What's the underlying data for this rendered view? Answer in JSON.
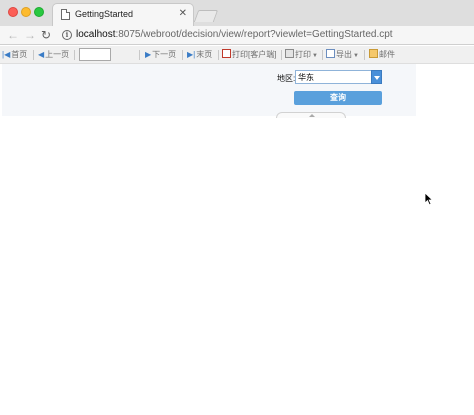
{
  "browser": {
    "tab": {
      "title": "GettingStarted",
      "close_icon": "close-icon",
      "doc_icon": "document-icon"
    },
    "address": {
      "host": "localhost",
      "path": ":8075/webroot/decision/view/report?viewlet=GettingStarted.cpt"
    },
    "nav": {
      "back_icon": "back-arrow-icon",
      "forward_icon": "forward-arrow-icon",
      "reload_icon": "reload-icon",
      "info_icon": "info-icon"
    }
  },
  "report_toolbar": {
    "first_page": "首页",
    "prev_page": "上一页",
    "page_input": "",
    "next_page": "下一页",
    "last_page": "末页",
    "print_client": "打印[客户端]",
    "print": "打印",
    "export": "导出",
    "mail": "邮件"
  },
  "parameters": {
    "region_label": "地区:",
    "region_value": "华东",
    "query_button": "查询"
  },
  "colors": {
    "accent": "#5aa0dc",
    "combo_arrow": "#4a90d9",
    "pane_background": "#f5f7fa"
  }
}
